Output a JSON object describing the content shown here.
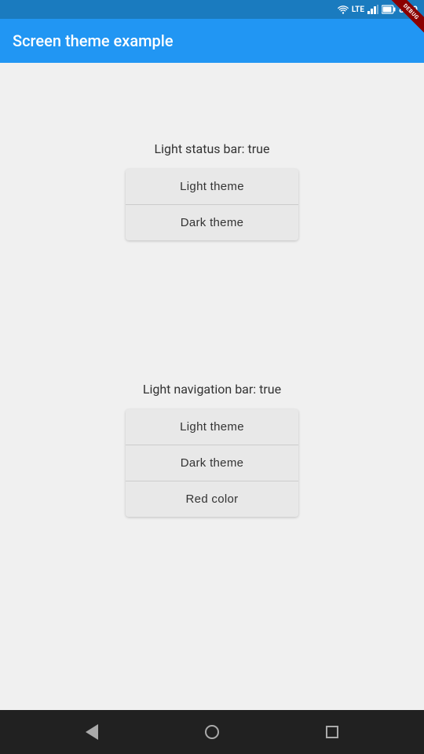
{
  "status_bar": {
    "time": "8:00",
    "debug_label": "DEBUG"
  },
  "app_bar": {
    "title": "Screen theme example"
  },
  "section1": {
    "label": "Light status bar: true",
    "buttons": [
      {
        "label": "Light theme",
        "id": "light-theme-status"
      },
      {
        "label": "Dark theme",
        "id": "dark-theme-status"
      }
    ]
  },
  "section2": {
    "label": "Light navigation bar: true",
    "buttons": [
      {
        "label": "Light theme",
        "id": "light-theme-nav"
      },
      {
        "label": "Dark theme",
        "id": "dark-theme-nav"
      },
      {
        "label": "Red color",
        "id": "red-color-nav"
      }
    ]
  },
  "nav_bar": {
    "back_label": "back",
    "home_label": "home",
    "recents_label": "recents"
  }
}
